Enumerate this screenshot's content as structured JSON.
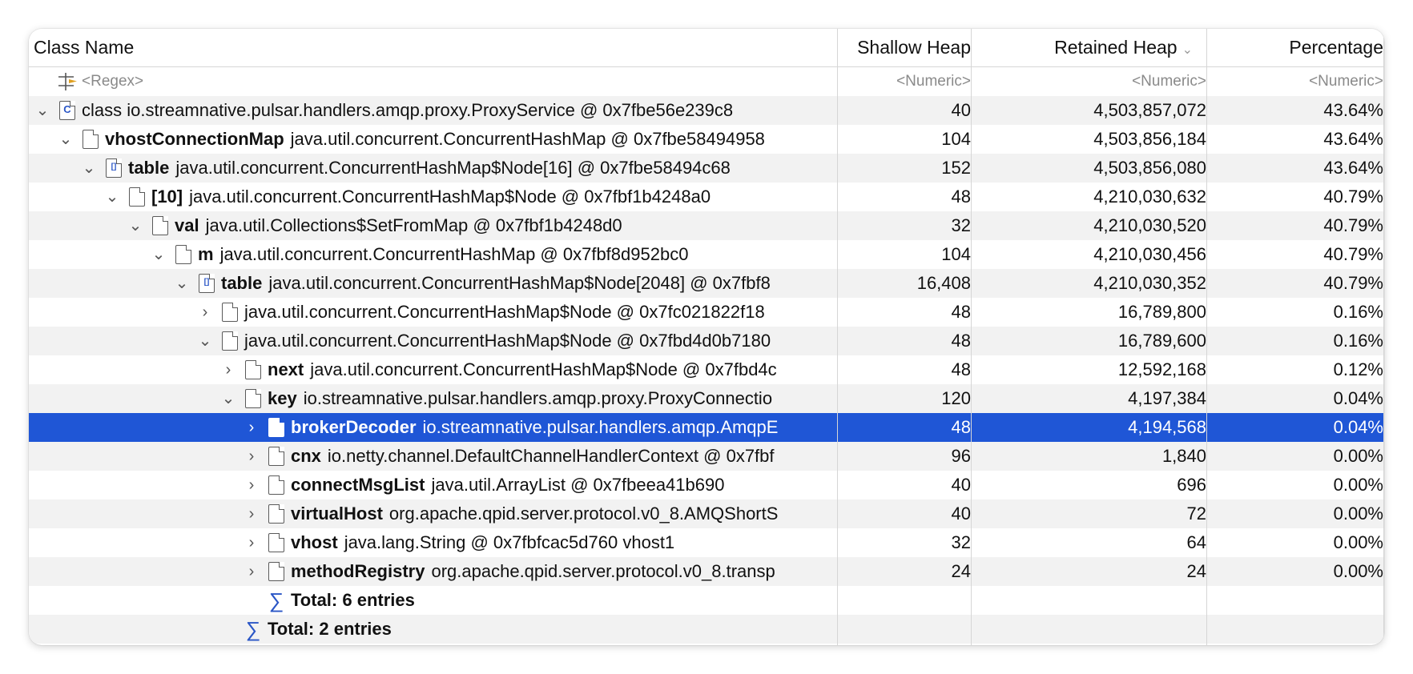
{
  "columns": {
    "class_name": "Class Name",
    "shallow_heap": "Shallow Heap",
    "retained_heap": "Retained Heap",
    "percentage": "Percentage",
    "sort_icon": "chevron-down-icon"
  },
  "filter_row": {
    "name": "<Regex>",
    "shallow": "<Numeric>",
    "retained": "<Numeric>",
    "percent": "<Numeric>"
  },
  "colors": {
    "selection": "#1f56d6",
    "alt_row": "#f2f2f2",
    "sigma": "#2a56c6"
  },
  "rows": [
    {
      "depth": 0,
      "toggle": "expanded",
      "icon": "class-icon",
      "field": "",
      "text": "class io.streamnative.pulsar.handlers.amqp.proxy.ProxyService @ 0x7fbe56e239c8",
      "shallow": "40",
      "retained": "4,503,857,072",
      "percent": "43.64%"
    },
    {
      "depth": 1,
      "toggle": "expanded",
      "icon": "object-icon",
      "field": "vhostConnectionMap",
      "text": "java.util.concurrent.ConcurrentHashMap @ 0x7fbe58494958",
      "shallow": "104",
      "retained": "4,503,856,184",
      "percent": "43.64%"
    },
    {
      "depth": 2,
      "toggle": "expanded",
      "icon": "array-icon",
      "field": "table",
      "text": "java.util.concurrent.ConcurrentHashMap$Node[16] @ 0x7fbe58494c68",
      "shallow": "152",
      "retained": "4,503,856,080",
      "percent": "43.64%"
    },
    {
      "depth": 3,
      "toggle": "expanded",
      "icon": "object-icon",
      "field": "[10]",
      "text": "java.util.concurrent.ConcurrentHashMap$Node @ 0x7fbf1b4248a0",
      "shallow": "48",
      "retained": "4,210,030,632",
      "percent": "40.79%"
    },
    {
      "depth": 4,
      "toggle": "expanded",
      "icon": "object-icon",
      "field": "val",
      "text": "java.util.Collections$SetFromMap @ 0x7fbf1b4248d0",
      "shallow": "32",
      "retained": "4,210,030,520",
      "percent": "40.79%"
    },
    {
      "depth": 5,
      "toggle": "expanded",
      "icon": "object-icon",
      "field": "m",
      "text": "java.util.concurrent.ConcurrentHashMap @ 0x7fbf8d952bc0",
      "shallow": "104",
      "retained": "4,210,030,456",
      "percent": "40.79%"
    },
    {
      "depth": 6,
      "toggle": "expanded",
      "icon": "array-icon",
      "field": "table",
      "text": "java.util.concurrent.ConcurrentHashMap$Node[2048] @ 0x7fbf8",
      "shallow": "16,408",
      "retained": "4,210,030,352",
      "percent": "40.79%"
    },
    {
      "depth": 7,
      "toggle": "collapsed",
      "icon": "object-icon",
      "field": "",
      "text": "java.util.concurrent.ConcurrentHashMap$Node @ 0x7fc021822f18",
      "shallow": "48",
      "retained": "16,789,800",
      "percent": "0.16%"
    },
    {
      "depth": 7,
      "toggle": "expanded",
      "icon": "object-icon",
      "field": "",
      "text": "java.util.concurrent.ConcurrentHashMap$Node @ 0x7fbd4d0b7180",
      "shallow": "48",
      "retained": "16,789,600",
      "percent": "0.16%"
    },
    {
      "depth": 8,
      "toggle": "collapsed",
      "icon": "object-icon",
      "field": "next",
      "text": "java.util.concurrent.ConcurrentHashMap$Node @ 0x7fbd4c",
      "shallow": "48",
      "retained": "12,592,168",
      "percent": "0.12%"
    },
    {
      "depth": 8,
      "toggle": "expanded",
      "icon": "object-icon",
      "field": "key",
      "text": "io.streamnative.pulsar.handlers.amqp.proxy.ProxyConnectio",
      "shallow": "120",
      "retained": "4,197,384",
      "percent": "0.04%"
    },
    {
      "depth": 9,
      "toggle": "collapsed",
      "icon": "object-icon",
      "field": "brokerDecoder",
      "text": "io.streamnative.pulsar.handlers.amqp.AmqpE",
      "shallow": "48",
      "retained": "4,194,568",
      "percent": "0.04%",
      "selected": true
    },
    {
      "depth": 9,
      "toggle": "collapsed",
      "icon": "object-icon",
      "field": "cnx",
      "text": "io.netty.channel.DefaultChannelHandlerContext @ 0x7fbf",
      "shallow": "96",
      "retained": "1,840",
      "percent": "0.00%"
    },
    {
      "depth": 9,
      "toggle": "collapsed",
      "icon": "object-icon",
      "field": "connectMsgList",
      "text": "java.util.ArrayList @ 0x7fbeea41b690",
      "shallow": "40",
      "retained": "696",
      "percent": "0.00%"
    },
    {
      "depth": 9,
      "toggle": "collapsed",
      "icon": "object-icon",
      "field": "virtualHost",
      "text": "org.apache.qpid.server.protocol.v0_8.AMQShortS",
      "shallow": "40",
      "retained": "72",
      "percent": "0.00%"
    },
    {
      "depth": 9,
      "toggle": "collapsed",
      "icon": "object-icon",
      "field": "vhost",
      "text": "java.lang.String @ 0x7fbfcac5d760  vhost1",
      "shallow": "32",
      "retained": "64",
      "percent": "0.00%"
    },
    {
      "depth": 9,
      "toggle": "collapsed",
      "icon": "object-icon",
      "field": "methodRegistry",
      "text": "org.apache.qpid.server.protocol.v0_8.transp",
      "shallow": "24",
      "retained": "24",
      "percent": "0.00%"
    },
    {
      "depth": 9,
      "toggle": "none",
      "icon": "sigma-icon",
      "field": "Total: 6 entries",
      "text": "",
      "shallow": "",
      "retained": "",
      "percent": "",
      "total": true
    },
    {
      "depth": 8,
      "toggle": "none",
      "icon": "sigma-icon",
      "field": "Total: 2 entries",
      "text": "",
      "shallow": "",
      "retained": "",
      "percent": "",
      "total": true
    }
  ]
}
